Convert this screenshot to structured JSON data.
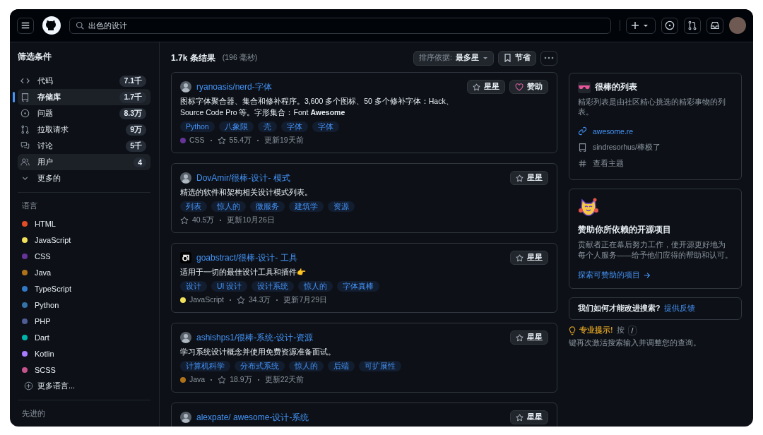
{
  "header": {
    "search": {
      "value": "出色的设计"
    }
  },
  "sidebar": {
    "title": "筛选条件",
    "types": [
      {
        "kind": "code",
        "label": "代码",
        "count": "7.1千",
        "selected": false,
        "hovered": false
      },
      {
        "kind": "repo",
        "label": "存储库",
        "count": "1.7千",
        "selected": true,
        "hovered": false
      },
      {
        "kind": "issue",
        "label": "问题",
        "count": "8.3万",
        "selected": false,
        "hovered": false
      },
      {
        "kind": "pr",
        "label": "拉取请求",
        "count": "9万",
        "selected": false,
        "hovered": false
      },
      {
        "kind": "discussion",
        "label": "讨论",
        "count": "5千",
        "selected": false,
        "hovered": false
      },
      {
        "kind": "user",
        "label": "用户",
        "count": "4",
        "selected": false,
        "hovered": true
      },
      {
        "kind": "more",
        "label": "更多的",
        "selected": false,
        "hovered": false
      }
    ],
    "languages_title": "语言",
    "languages": [
      {
        "name": "HTML",
        "color": "#e34c26"
      },
      {
        "name": "JavaScript",
        "color": "#f1e05a"
      },
      {
        "name": "CSS",
        "color": "#663399"
      },
      {
        "name": "Java",
        "color": "#b07219"
      },
      {
        "name": "TypeScript",
        "color": "#3178c6"
      },
      {
        "name": "Python",
        "color": "#3572a5"
      },
      {
        "name": "PHP",
        "color": "#4f5d95"
      },
      {
        "name": "Dart",
        "color": "#00b4ab"
      },
      {
        "name": "Kotlin",
        "color": "#a97bff"
      },
      {
        "name": "SCSS",
        "color": "#c6538c"
      }
    ],
    "more_languages": "更多语言...",
    "advanced_title": "先进的"
  },
  "results": {
    "count": "1.7k 条结果",
    "time": "(196 毫秒)",
    "sort_label": "排序依据:",
    "sort_value": "最多星",
    "save": "节省"
  },
  "repos": [
    {
      "kind": "photo",
      "title": "ryanoasis/nerd-字体",
      "description": "图标字体聚合器、集合和修补程序。3,600 多个图标、50 多个修补字体：Hack、Source Code Pro 等。字形集合：Font **Awesome**",
      "topics": [
        "Python",
        "八象限",
        "壳",
        "字体",
        "字体"
      ],
      "language": {
        "name": "CSS",
        "color": "#663399"
      },
      "stars": "55.4万",
      "updated": "更新19天前",
      "star_button": "星星",
      "sponsor_button": "赞助"
    },
    {
      "kind": "photo",
      "title": "DovAmir/很棒-设计- 模式",
      "description": "精选的软件和架构相关设计模式列表。",
      "topics": [
        "列表",
        "惊人的",
        "微服务",
        "建筑学",
        "资源"
      ],
      "stars": "40.5万",
      "updated": "更新10月26日",
      "star_button": "星星"
    },
    {
      "kind": "logo",
      "title": "goabstract/很棒-设计- 工具",
      "description": "适用于一切的最佳设计工具和插件👉",
      "topics": [
        "设计",
        "UI 设计",
        "设计系统",
        "惊人的",
        "字体真棒"
      ],
      "language": {
        "name": "JavaScript",
        "color": "#f1e05a"
      },
      "stars": "34.3万",
      "updated": "更新7月29日",
      "star_button": "星星"
    },
    {
      "kind": "photo",
      "title": "ashishps1/很棒-系统-设计-资源",
      "description": "学习系统设计概念并使用免费资源准备面试。",
      "topics": [
        "计算机科学",
        "分布式系统",
        "惊人的",
        "后端",
        "可扩展性"
      ],
      "language": {
        "name": "Java",
        "color": "#b07219"
      },
      "stars": "18.9万",
      "updated": "更新22天前",
      "star_button": "星星"
    },
    {
      "kind": "photo",
      "title": "alexpate/ awesome-设计-系统",
      "star_button": "星星"
    }
  ],
  "aside": {
    "awesome": {
      "title": "很棒的列表",
      "description": "精彩列表是由社区精心挑选的精彩事物的列表。",
      "links": [
        {
          "kind": "link",
          "text": "awesome.re"
        },
        {
          "kind": "repo",
          "text": "sindresorhus/棒极了"
        },
        {
          "kind": "topic",
          "text": "查看主题"
        }
      ]
    },
    "sponsor": {
      "title": "赞助你所依赖的开源项目",
      "description": "贡献者正在幕后努力工作，使开源更好地为每个人服务——给予他们应得的帮助和认可。",
      "link": "探索可赞助的项目"
    },
    "feedback": {
      "question": "我们如何才能改进搜索?",
      "link": "提供反馈"
    },
    "tip": {
      "label": "专业提示!",
      "before": "按",
      "key": "/",
      "after": "键再次激活搜索输入并调整您的查询。"
    }
  }
}
